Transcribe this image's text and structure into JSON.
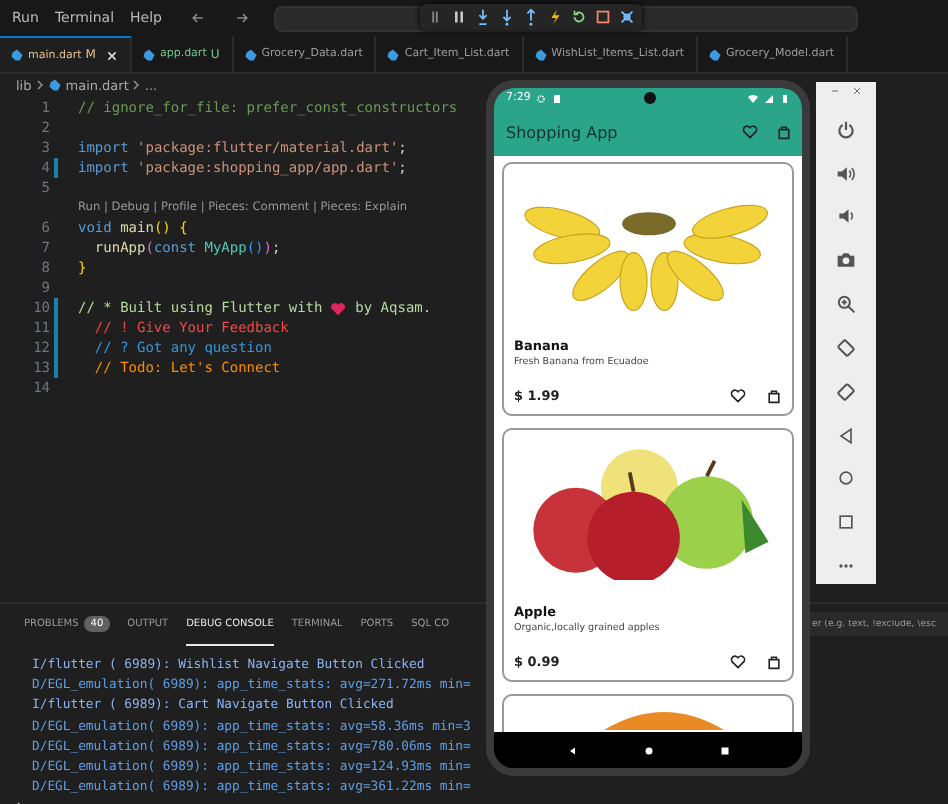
{
  "menu": [
    "Run",
    "Terminal",
    "Help"
  ],
  "tabs": [
    {
      "label": "main.dart",
      "badge": "M",
      "kind": "modified",
      "selected": true
    },
    {
      "label": "app.dart",
      "badge": "U",
      "kind": "untracked",
      "selected": false
    },
    {
      "label": "Grocery_Data.dart",
      "kind": "plain",
      "selected": false
    },
    {
      "label": "Cart_Item_List.dart",
      "kind": "plain",
      "selected": false
    },
    {
      "label": "WishList_Items_List.dart",
      "kind": "plain",
      "selected": false
    },
    {
      "label": "Grocery_Model.dart",
      "kind": "plain",
      "selected": false
    }
  ],
  "breadcrumb": [
    "lib",
    "main.dart",
    "..."
  ],
  "code": [
    {
      "kind": "code",
      "number": "1",
      "changed": false,
      "tokens": [
        {
          "kind": "comment",
          "text": "// ignore_for_file: prefer_const_constructors"
        }
      ]
    },
    {
      "kind": "code",
      "number": "2",
      "changed": false
    },
    {
      "kind": "code",
      "number": "3",
      "changed": false,
      "tokens": [
        {
          "kind": "keyword",
          "text": "import"
        },
        {
          "kind": "string",
          "text": " 'package:flutter/material.dart'"
        },
        {
          "kind": "punct",
          "text": ";"
        }
      ]
    },
    {
      "kind": "code",
      "number": "4",
      "changed": true,
      "tokens": [
        {
          "kind": "keyword",
          "text": "import"
        },
        {
          "kind": "string",
          "text": " 'package:shopping_app/app.dart'"
        },
        {
          "kind": "punct",
          "text": ";"
        }
      ]
    },
    {
      "kind": "code",
      "number": "5",
      "changed": false
    },
    {
      "kind": "codelens",
      "text": "Run | Debug | Profile | Pieces: Comment | Pieces: Explain"
    },
    {
      "kind": "code",
      "number": "6",
      "changed": false,
      "tokens": [
        {
          "kind": "keyword",
          "text": "void"
        },
        {
          "kind": "function",
          "text": " main"
        },
        {
          "kind": "bracket",
          "text": "() {"
        }
      ]
    },
    {
      "kind": "code",
      "number": "7",
      "changed": false,
      "tokens": [
        {
          "kind": "function",
          "text": "  runApp"
        },
        {
          "kind": "bracket2",
          "text": "("
        },
        {
          "kind": "keyword",
          "text": "const"
        },
        {
          "kind": "class",
          "text": " MyApp"
        },
        {
          "kind": "bracket3",
          "text": "()"
        },
        {
          "kind": "bracket2",
          "text": ")"
        },
        {
          "kind": "punct",
          "text": ";"
        }
      ]
    },
    {
      "kind": "code",
      "number": "8",
      "changed": false,
      "tokens": [
        {
          "kind": "bracket",
          "text": "}"
        }
      ]
    },
    {
      "kind": "code",
      "number": "9",
      "changed": false
    },
    {
      "kind": "code",
      "number": "10",
      "changed": true,
      "tokens": [
        {
          "kind": "highlight",
          "text": "// * Built using Flutter with "
        },
        {
          "kind": "heart"
        },
        {
          "kind": "highlight",
          "text": " by Aqsam."
        }
      ]
    },
    {
      "kind": "code",
      "number": "11",
      "changed": true,
      "tokens": [
        {
          "kind": "alert",
          "text": "  // ! Give Your Feedback"
        }
      ]
    },
    {
      "kind": "code",
      "number": "12",
      "changed": true,
      "tokens": [
        {
          "kind": "query",
          "text": "  // ? Got any question"
        }
      ]
    },
    {
      "kind": "code",
      "number": "13",
      "changed": true,
      "tokens": [
        {
          "kind": "todo",
          "text": "  // Todo: Let's Connect"
        }
      ]
    },
    {
      "kind": "code",
      "number": "14",
      "changed": false
    }
  ],
  "panel": {
    "tabs": [
      {
        "label": "PROBLEMS",
        "badge": "40",
        "selected": false
      },
      {
        "label": "OUTPUT",
        "selected": false
      },
      {
        "label": "DEBUG CONSOLE",
        "selected": true
      },
      {
        "label": "TERMINAL",
        "selected": false
      },
      {
        "label": "PORTS",
        "selected": false
      },
      {
        "label": "SQL CO",
        "selected": false
      }
    ],
    "filter": {
      "placeholder": "er (e.g. text, !exclude, \\esc"
    },
    "console": [
      {
        "kind": "info",
        "text": "I/flutter ( 6989): Wishlist Navigate Button Clicked"
      },
      {
        "kind": "debug",
        "text": "D/EGL_emulation( 6989): app_time_stats: avg=271.72ms min="
      },
      {
        "kind": "info",
        "text": "I/flutter ( 6989): Cart Navigate Button Clicked"
      },
      {
        "kind": "debug",
        "text": "D/EGL_emulation( 6989): app_time_stats: avg=58.36ms min=3"
      },
      {
        "kind": "debug",
        "text": "D/EGL_emulation( 6989): app_time_stats: avg=780.06ms min="
      },
      {
        "kind": "debug",
        "text": "D/EGL_emulation( 6989): app_time_stats: avg=124.93ms min="
      },
      {
        "kind": "debug",
        "text": "D/EGL_emulation( 6989): app_time_stats: avg=361.22ms min="
      }
    ]
  },
  "phone": {
    "time": "7:29",
    "title": "Shopping App",
    "products": [
      {
        "kind": "banana",
        "name": "Banana",
        "description": "Fresh Banana from Ecuadoe",
        "price": "$ 1.99"
      },
      {
        "kind": "apple",
        "name": "Apple",
        "description": "Organic,locally grained apples",
        "price": "$ 0.99"
      },
      {
        "kind": "orange"
      }
    ]
  }
}
